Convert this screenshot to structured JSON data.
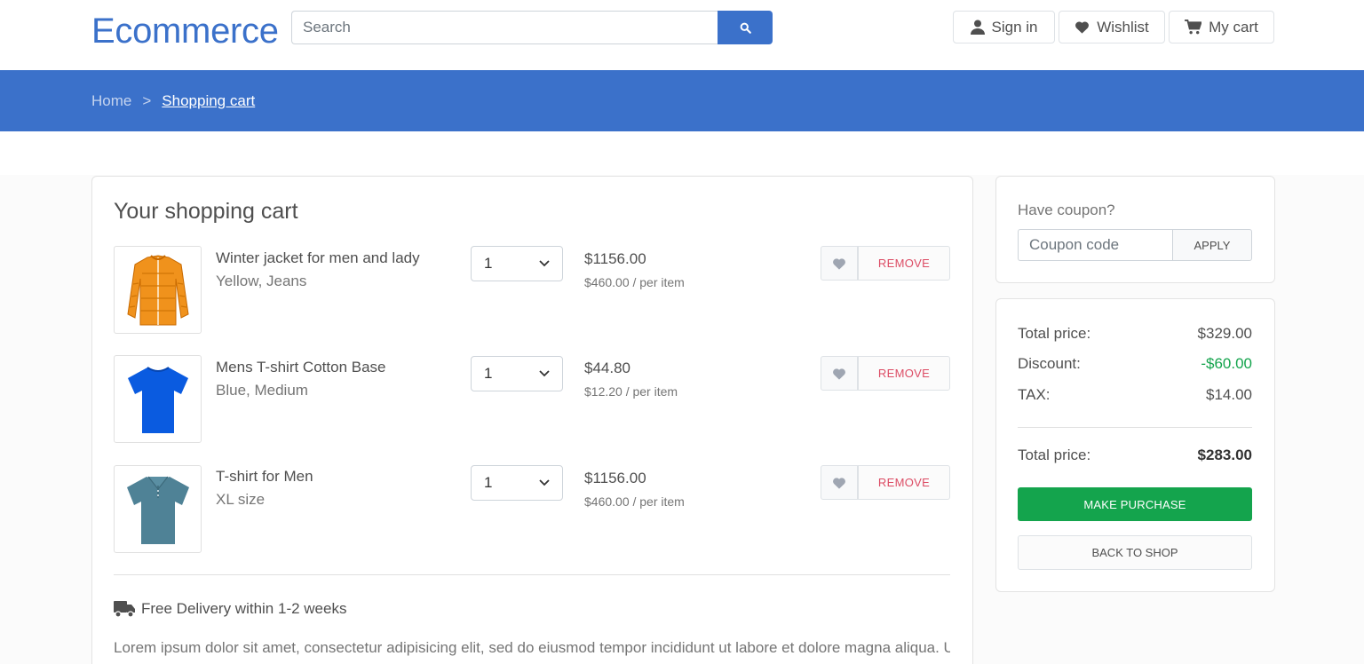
{
  "header": {
    "brand": "Ecommerce",
    "search_placeholder": "Search",
    "signin_label": "Sign in",
    "wishlist_label": "Wishlist",
    "cart_label": "My cart",
    "accent": "#3b71ca"
  },
  "breadcrumb": {
    "home": "Home",
    "separator": ">",
    "current": "Shopping cart"
  },
  "cart": {
    "title": "Your shopping cart",
    "remove_label": "REMOVE",
    "items": [
      {
        "name": "Winter jacket for men and lady",
        "variant": "Yellow, Jeans",
        "qty": "1",
        "price": "$1156.00",
        "unit_price": "$460.00 / per item",
        "image": "jacket-image"
      },
      {
        "name": "Mens T-shirt Cotton Base",
        "variant": "Blue, Medium",
        "qty": "1",
        "price": "$44.80",
        "unit_price": "$12.20 / per item",
        "image": "tshirt-image"
      },
      {
        "name": "T-shirt for Men",
        "variant": "XL size",
        "qty": "1",
        "price": "$1156.00",
        "unit_price": "$460.00 / per item",
        "image": "polo-image"
      }
    ],
    "delivery": "Free Delivery within 1-2 weeks",
    "description": "Lorem ipsum dolor sit amet, consectetur adipisicing elit, sed do eiusmod tempor incididunt ut labore et dolore magna aliqua. Ut"
  },
  "coupon": {
    "label": "Have coupon?",
    "placeholder": "Coupon code",
    "apply_label": "APPLY"
  },
  "summary": {
    "total_label": "Total price:",
    "total_value": "$329.00",
    "discount_label": "Discount:",
    "discount_value": "-$60.00",
    "tax_label": "TAX:",
    "tax_value": "$14.00",
    "grand_label": "Total price:",
    "grand_value": "$283.00",
    "purchase_label": "MAKE PURCHASE",
    "back_label": "BACK TO SHOP",
    "green": "#14a44d"
  }
}
